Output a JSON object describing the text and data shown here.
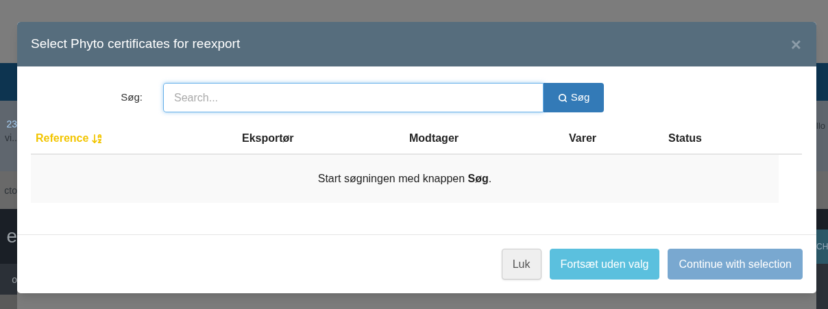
{
  "backdrop": {
    "left_fragments": [
      "23",
      "vi..",
      "cto",
      "e",
      "o"
    ],
    "right_fragments": [
      "llo",
      "CH"
    ]
  },
  "dialog": {
    "title": "Select Phyto certificates for reexport",
    "close": "×",
    "search": {
      "label": "Søg:",
      "placeholder": "Search...",
      "button": "Søg"
    },
    "table": {
      "columns": [
        {
          "label": "Reference",
          "sorted": true
        },
        {
          "label": "Eksportør",
          "sorted": false
        },
        {
          "label": "Modtager",
          "sorted": false
        },
        {
          "label": "Varer",
          "sorted": false
        },
        {
          "label": "Status",
          "sorted": false
        }
      ],
      "empty_message": "Start søgningen med knappen **Søg**."
    },
    "buttons": [
      {
        "label": "Luk",
        "kind": "default",
        "disabled": false
      },
      {
        "label": "Fortsæt uden valg",
        "kind": "info",
        "disabled": false
      },
      {
        "label": "Continue with selection",
        "kind": "primary",
        "disabled": true
      }
    ]
  }
}
